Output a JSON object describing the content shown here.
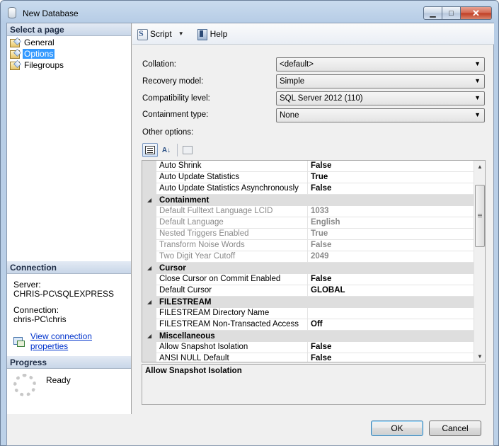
{
  "window": {
    "title": "New Database"
  },
  "left": {
    "select_page_header": "Select a page",
    "pages": [
      {
        "label": "General",
        "selected": false
      },
      {
        "label": "Options",
        "selected": true
      },
      {
        "label": "Filegroups",
        "selected": false
      }
    ],
    "connection_header": "Connection",
    "server_label": "Server:",
    "server_value": "CHRIS-PC\\SQLEXPRESS",
    "connection_label": "Connection:",
    "connection_value": "chris-PC\\chris",
    "view_props_link": "View connection properties",
    "progress_header": "Progress",
    "progress_status": "Ready"
  },
  "toolbar": {
    "script_label": "Script",
    "help_label": "Help"
  },
  "form": {
    "collation": {
      "label": "Collation:",
      "value": "<default>"
    },
    "recovery": {
      "label": "Recovery model:",
      "value": "Simple"
    },
    "compat": {
      "label": "Compatibility level:",
      "value": "SQL Server 2012 (110)"
    },
    "containment": {
      "label": "Containment type:",
      "value": "None"
    },
    "other_options_label": "Other options:"
  },
  "grid": {
    "rows": [
      {
        "type": "prop",
        "name": "Auto Shrink",
        "value": "False",
        "disabled": false
      },
      {
        "type": "prop",
        "name": "Auto Update Statistics",
        "value": "True",
        "disabled": false
      },
      {
        "type": "prop",
        "name": "Auto Update Statistics Asynchronously",
        "value": "False",
        "disabled": false
      },
      {
        "type": "cat",
        "name": "Containment"
      },
      {
        "type": "prop",
        "name": "Default Fulltext Language LCID",
        "value": "1033",
        "disabled": true
      },
      {
        "type": "prop",
        "name": "Default Language",
        "value": "English",
        "disabled": true
      },
      {
        "type": "prop",
        "name": "Nested Triggers Enabled",
        "value": "True",
        "disabled": true
      },
      {
        "type": "prop",
        "name": "Transform Noise Words",
        "value": "False",
        "disabled": true
      },
      {
        "type": "prop",
        "name": "Two Digit Year Cutoff",
        "value": "2049",
        "disabled": true
      },
      {
        "type": "cat",
        "name": "Cursor"
      },
      {
        "type": "prop",
        "name": "Close Cursor on Commit Enabled",
        "value": "False",
        "disabled": false
      },
      {
        "type": "prop",
        "name": "Default Cursor",
        "value": "GLOBAL",
        "disabled": false
      },
      {
        "type": "cat",
        "name": "FILESTREAM"
      },
      {
        "type": "prop",
        "name": "FILESTREAM Directory Name",
        "value": "",
        "disabled": false
      },
      {
        "type": "prop",
        "name": "FILESTREAM Non-Transacted Access",
        "value": "Off",
        "disabled": false
      },
      {
        "type": "cat",
        "name": "Miscellaneous"
      },
      {
        "type": "prop",
        "name": "Allow Snapshot Isolation",
        "value": "False",
        "disabled": false
      },
      {
        "type": "prop",
        "name": "ANSI NULL Default",
        "value": "False",
        "disabled": false
      }
    ],
    "description": "Allow Snapshot Isolation"
  },
  "buttons": {
    "ok": "OK",
    "cancel": "Cancel"
  }
}
